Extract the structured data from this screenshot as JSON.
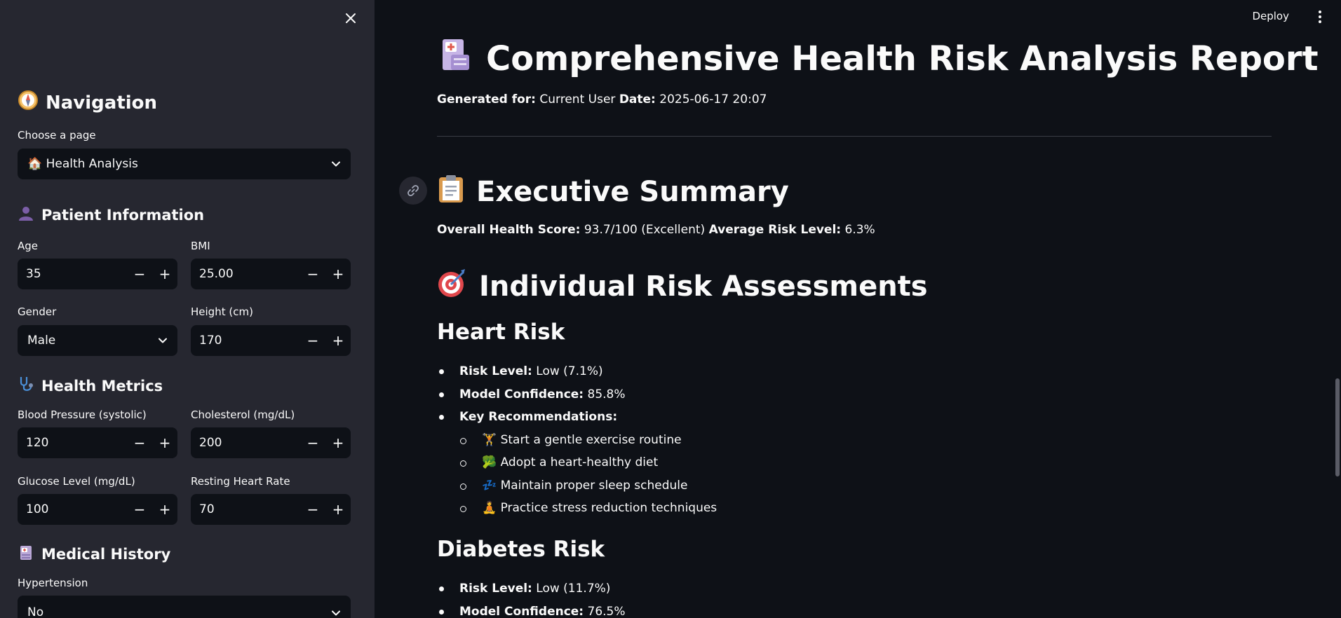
{
  "sidebar": {
    "navigation": {
      "title": "Navigation",
      "page_label": "Choose a page",
      "page_value": "🏠 Health Analysis"
    },
    "patient_info": {
      "title": "Patient Information",
      "age": {
        "label": "Age",
        "value": "35"
      },
      "bmi": {
        "label": "BMI",
        "value": "25.00"
      },
      "gender": {
        "label": "Gender",
        "value": "Male"
      },
      "height": {
        "label": "Height (cm)",
        "value": "170"
      }
    },
    "health_metrics": {
      "title": "Health Metrics",
      "bp": {
        "label": "Blood Pressure (systolic)",
        "value": "120"
      },
      "cholesterol": {
        "label": "Cholesterol (mg/dL)",
        "value": "200"
      },
      "glucose": {
        "label": "Glucose Level (mg/dL)",
        "value": "100"
      },
      "heart_rate": {
        "label": "Resting Heart Rate",
        "value": "70"
      }
    },
    "medical_history": {
      "title": "Medical History",
      "hypertension": {
        "label": "Hypertension",
        "value": "No"
      }
    }
  },
  "toolbar": {
    "deploy": "Deploy"
  },
  "report": {
    "title": "Comprehensive Health Risk Analysis Report",
    "generated_for_label": "Generated for:",
    "generated_for_value": "Current User",
    "date_label": "Date:",
    "date_value": "2025-06-17 20:07",
    "summary_title": "Executive Summary",
    "health_score_label": "Overall Health Score:",
    "health_score_value": "93.7/100 (Excellent)",
    "avg_risk_label": "Average Risk Level:",
    "avg_risk_value": "6.3%",
    "assessments_title": "Individual Risk Assessments",
    "heart": {
      "title": "Heart Risk",
      "risk_level_label": "Risk Level:",
      "risk_level_value": "Low (7.1%)",
      "confidence_label": "Model Confidence:",
      "confidence_value": "85.8%",
      "recs_label": "Key Recommendations:",
      "recs": [
        "🏋️ Start a gentle exercise routine",
        "🥦 Adopt a heart-healthy diet",
        "💤 Maintain proper sleep schedule",
        "🧘 Practice stress reduction techniques"
      ]
    },
    "diabetes": {
      "title": "Diabetes Risk",
      "risk_level_label": "Risk Level:",
      "risk_level_value": "Low (11.7%)",
      "confidence_label": "Model Confidence:",
      "confidence_value": "76.5%"
    }
  }
}
